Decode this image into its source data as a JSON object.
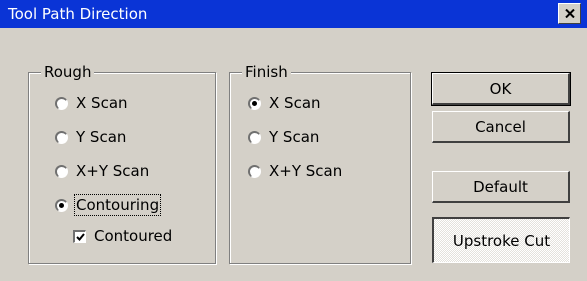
{
  "window": {
    "title": "Tool Path Direction"
  },
  "rough": {
    "legend": "Rough",
    "options": [
      {
        "label": "X Scan",
        "checked": false
      },
      {
        "label": "Y Scan",
        "checked": false
      },
      {
        "label": "X+Y Scan",
        "checked": false
      },
      {
        "label": "Contouring",
        "checked": true
      }
    ],
    "contoured": {
      "label": "Contoured",
      "checked": true
    }
  },
  "finish": {
    "legend": "Finish",
    "options": [
      {
        "label": "X Scan",
        "checked": true
      },
      {
        "label": "Y Scan",
        "checked": false
      },
      {
        "label": "X+Y Scan",
        "checked": false
      }
    ]
  },
  "buttons": {
    "ok": "OK",
    "cancel": "Cancel",
    "default": "Default",
    "upstroke": "Upstroke Cut"
  },
  "colors": {
    "titlebar": "#0a34d6",
    "face": "#d4d0c8"
  }
}
